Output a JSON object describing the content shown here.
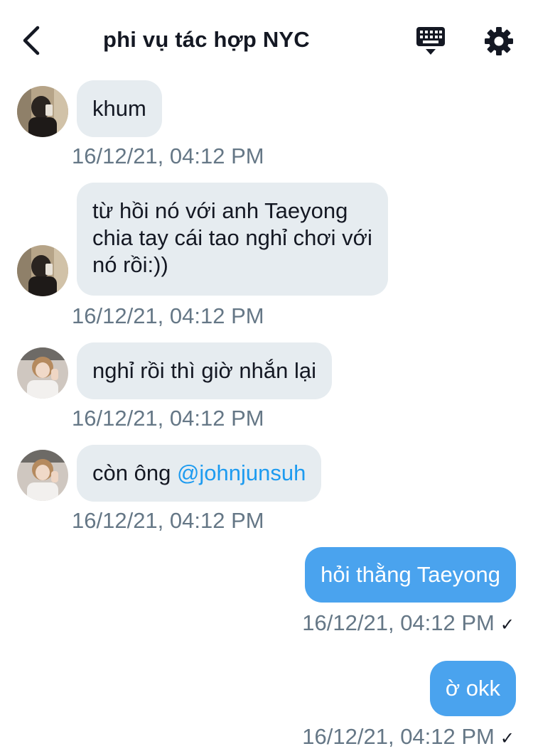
{
  "header": {
    "title": "phi vụ tác hợp NYC",
    "back_icon": "chevron-left-icon",
    "keyboard_icon": "keyboard-icon",
    "settings_icon": "gear-icon"
  },
  "colors": {
    "incoming_bubble": "#e6ecf0",
    "outgoing_bubble": "#4aa3ee",
    "timestamp": "#657786",
    "mention": "#1d9bf0"
  },
  "messages": [
    {
      "direction": "incoming",
      "text": "khum",
      "time": "16/12/21, 04:12 PM"
    },
    {
      "direction": "incoming",
      "lines": [
        "từ hồi nó với anh Taeyong",
        "chia tay cái tao nghỉ chơi với",
        "nó rồi:))"
      ],
      "time": "16/12/21, 04:12 PM"
    },
    {
      "direction": "incoming",
      "text": "nghỉ rồi thì giờ nhắn lại",
      "time": "16/12/21, 04:12 PM"
    },
    {
      "direction": "incoming",
      "text_prefix": "còn ông ",
      "mention": "@johnjunsuh",
      "time": "16/12/21, 04:12 PM"
    },
    {
      "direction": "outgoing",
      "text": "hỏi thằng Taeyong",
      "time": "16/12/21, 04:12 PM",
      "status": "✓"
    },
    {
      "direction": "outgoing",
      "text": "ờ okk",
      "time": "16/12/21, 04:12 PM",
      "status": "✓"
    }
  ]
}
